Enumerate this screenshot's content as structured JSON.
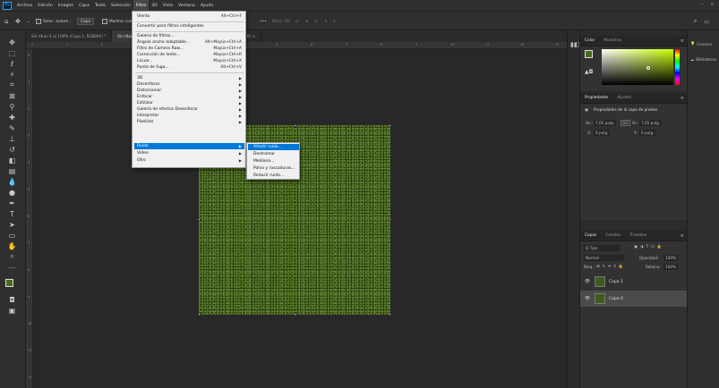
{
  "menubar": {
    "items": [
      "Archivo",
      "Edición",
      "Imagen",
      "Capa",
      "Texto",
      "Selección",
      "Filtro",
      "3D",
      "Vista",
      "Ventana",
      "Ayuda"
    ],
    "active_index": 6
  },
  "options_bar": {
    "auto_select_label": "Selec. autom.:",
    "auto_select_value": "Capa",
    "show_transform_label": "Mostrar con",
    "mode_3d_label": "Modo 3D:",
    "more_label": "•••"
  },
  "tabs": [
    {
      "label": "Sin título-1 al 100% (Capa 1, RGB/8#) *",
      "active": false
    },
    {
      "label": "Sin título-2",
      "active": true
    },
    {
      "label": "RGB/8#) ×",
      "active": false
    }
  ],
  "rulers": {
    "top": [
      "2",
      "1",
      "0",
      "1",
      "2",
      "3",
      "4",
      "5",
      "6",
      "7",
      "8",
      "9",
      "10",
      "11",
      "12",
      "13"
    ],
    "left": [
      "0",
      "1",
      "2",
      "3",
      "4",
      "5",
      "6",
      "7",
      "8",
      "9",
      "10",
      "11",
      "12"
    ]
  },
  "filter_menu": {
    "items": [
      {
        "label": "Viento",
        "shortcut": "Alt+Ctrl+F"
      },
      {
        "label": "Convertir para filtros inteligentes",
        "shortcut": ""
      },
      {
        "label": "Galería de filtros...",
        "shortcut": ""
      },
      {
        "label": "Ángulo ancho adaptable...",
        "shortcut": "Alt+Mayús+Ctrl+A"
      },
      {
        "label": "Filtro de Camera Raw...",
        "shortcut": "Mayús+Ctrl+A"
      },
      {
        "label": "Corrección de lente...",
        "shortcut": "Mayús+Ctrl+R"
      },
      {
        "label": "Licuar...",
        "shortcut": "Mayús+Ctrl+X"
      },
      {
        "label": "Punto de fuga...",
        "shortcut": "Alt+Ctrl+V"
      },
      {
        "label": "3D",
        "shortcut": ""
      },
      {
        "label": "Desenfocar",
        "shortcut": ""
      },
      {
        "label": "Distorsionar",
        "shortcut": ""
      },
      {
        "label": "Enfocar",
        "shortcut": ""
      },
      {
        "label": "Estilizar",
        "shortcut": ""
      },
      {
        "label": "Galería de efectos Desenfocar",
        "shortcut": ""
      },
      {
        "label": "Interpretar",
        "shortcut": ""
      },
      {
        "label": "Pixelizar",
        "shortcut": ""
      },
      {
        "label": "Ruido",
        "shortcut": ""
      },
      {
        "label": "Vídeo",
        "shortcut": ""
      },
      {
        "label": "Otro",
        "shortcut": ""
      }
    ],
    "highlighted": "Ruido"
  },
  "noise_submenu": {
    "items": [
      "Añadir ruido...",
      "Destramar",
      "Mediana...",
      "Polvo y rascaduras...",
      "Reducir ruido..."
    ],
    "highlighted": "Añadir ruido..."
  },
  "color_panel": {
    "tabs": [
      "Color",
      "Muestras"
    ],
    "foreground_color": "#4a6a1f",
    "background_color": "#ffffff"
  },
  "properties_panel": {
    "tabs": [
      "Propiedades",
      "Ajustes"
    ],
    "title": "Propiedades de la capa de píxeles",
    "width_label": "An.:",
    "width_value": "7,05 pulg.",
    "link_label": "GO",
    "height_label": "Al.:",
    "height_value": "7,05 pulg.",
    "x_label": "X:",
    "x_value": "0 pulg.",
    "y_label": "Y:",
    "y_value": "0 pulg."
  },
  "layers_panel": {
    "tabs": [
      "Capas",
      "Canales",
      "Trazados"
    ],
    "filter_label": "Q Tipo",
    "blend_mode": "Normal",
    "opacity_label": "Opacidad:",
    "opacity_value": "100%",
    "lock_label": "Bloq.:",
    "fill_label": "Relleno:",
    "fill_value": "100%",
    "layers": [
      {
        "name": "Capa 1",
        "selected": false
      },
      {
        "name": "Capa 0",
        "selected": true
      }
    ]
  },
  "far_right": {
    "items": [
      "Conocer",
      "Bibliotecas"
    ]
  },
  "icons": [
    "ps-logo",
    "move-icon",
    "marquee-icon",
    "lasso-icon",
    "magic-wand-icon",
    "crop-icon",
    "frame-icon",
    "eyedropper-icon",
    "healing-icon",
    "brush-icon",
    "stamp-icon",
    "history-brush-icon",
    "eraser-icon",
    "gradient-icon",
    "blur-icon",
    "dodge-icon",
    "pen-icon",
    "type-icon",
    "path-select-icon",
    "rectangle-icon",
    "hand-icon",
    "zoom-icon",
    "more-tools-icon",
    "home-icon",
    "search-icon",
    "eye-icon"
  ]
}
